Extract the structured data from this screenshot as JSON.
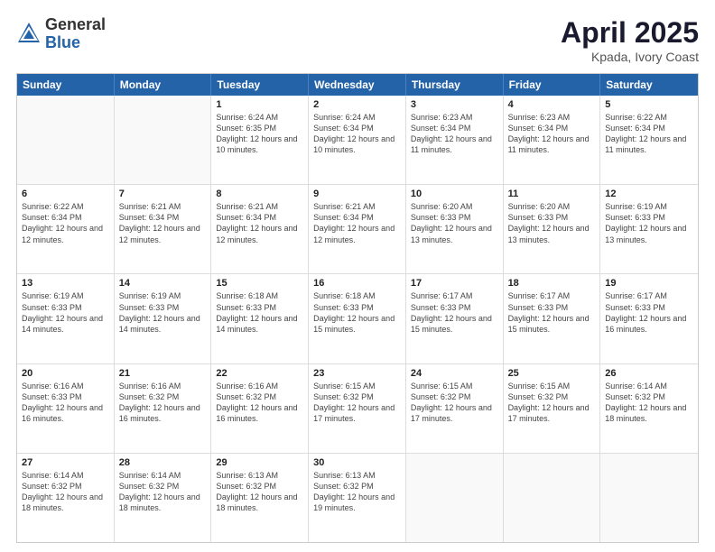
{
  "logo": {
    "general": "General",
    "blue": "Blue"
  },
  "title": "April 2025",
  "location": "Kpada, Ivory Coast",
  "header_days": [
    "Sunday",
    "Monday",
    "Tuesday",
    "Wednesday",
    "Thursday",
    "Friday",
    "Saturday"
  ],
  "rows": [
    [
      {
        "day": "",
        "info": ""
      },
      {
        "day": "",
        "info": ""
      },
      {
        "day": "1",
        "info": "Sunrise: 6:24 AM\nSunset: 6:35 PM\nDaylight: 12 hours and 10 minutes."
      },
      {
        "day": "2",
        "info": "Sunrise: 6:24 AM\nSunset: 6:34 PM\nDaylight: 12 hours and 10 minutes."
      },
      {
        "day": "3",
        "info": "Sunrise: 6:23 AM\nSunset: 6:34 PM\nDaylight: 12 hours and 11 minutes."
      },
      {
        "day": "4",
        "info": "Sunrise: 6:23 AM\nSunset: 6:34 PM\nDaylight: 12 hours and 11 minutes."
      },
      {
        "day": "5",
        "info": "Sunrise: 6:22 AM\nSunset: 6:34 PM\nDaylight: 12 hours and 11 minutes."
      }
    ],
    [
      {
        "day": "6",
        "info": "Sunrise: 6:22 AM\nSunset: 6:34 PM\nDaylight: 12 hours and 12 minutes."
      },
      {
        "day": "7",
        "info": "Sunrise: 6:21 AM\nSunset: 6:34 PM\nDaylight: 12 hours and 12 minutes."
      },
      {
        "day": "8",
        "info": "Sunrise: 6:21 AM\nSunset: 6:34 PM\nDaylight: 12 hours and 12 minutes."
      },
      {
        "day": "9",
        "info": "Sunrise: 6:21 AM\nSunset: 6:34 PM\nDaylight: 12 hours and 12 minutes."
      },
      {
        "day": "10",
        "info": "Sunrise: 6:20 AM\nSunset: 6:33 PM\nDaylight: 12 hours and 13 minutes."
      },
      {
        "day": "11",
        "info": "Sunrise: 6:20 AM\nSunset: 6:33 PM\nDaylight: 12 hours and 13 minutes."
      },
      {
        "day": "12",
        "info": "Sunrise: 6:19 AM\nSunset: 6:33 PM\nDaylight: 12 hours and 13 minutes."
      }
    ],
    [
      {
        "day": "13",
        "info": "Sunrise: 6:19 AM\nSunset: 6:33 PM\nDaylight: 12 hours and 14 minutes."
      },
      {
        "day": "14",
        "info": "Sunrise: 6:19 AM\nSunset: 6:33 PM\nDaylight: 12 hours and 14 minutes."
      },
      {
        "day": "15",
        "info": "Sunrise: 6:18 AM\nSunset: 6:33 PM\nDaylight: 12 hours and 14 minutes."
      },
      {
        "day": "16",
        "info": "Sunrise: 6:18 AM\nSunset: 6:33 PM\nDaylight: 12 hours and 15 minutes."
      },
      {
        "day": "17",
        "info": "Sunrise: 6:17 AM\nSunset: 6:33 PM\nDaylight: 12 hours and 15 minutes."
      },
      {
        "day": "18",
        "info": "Sunrise: 6:17 AM\nSunset: 6:33 PM\nDaylight: 12 hours and 15 minutes."
      },
      {
        "day": "19",
        "info": "Sunrise: 6:17 AM\nSunset: 6:33 PM\nDaylight: 12 hours and 16 minutes."
      }
    ],
    [
      {
        "day": "20",
        "info": "Sunrise: 6:16 AM\nSunset: 6:33 PM\nDaylight: 12 hours and 16 minutes."
      },
      {
        "day": "21",
        "info": "Sunrise: 6:16 AM\nSunset: 6:32 PM\nDaylight: 12 hours and 16 minutes."
      },
      {
        "day": "22",
        "info": "Sunrise: 6:16 AM\nSunset: 6:32 PM\nDaylight: 12 hours and 16 minutes."
      },
      {
        "day": "23",
        "info": "Sunrise: 6:15 AM\nSunset: 6:32 PM\nDaylight: 12 hours and 17 minutes."
      },
      {
        "day": "24",
        "info": "Sunrise: 6:15 AM\nSunset: 6:32 PM\nDaylight: 12 hours and 17 minutes."
      },
      {
        "day": "25",
        "info": "Sunrise: 6:15 AM\nSunset: 6:32 PM\nDaylight: 12 hours and 17 minutes."
      },
      {
        "day": "26",
        "info": "Sunrise: 6:14 AM\nSunset: 6:32 PM\nDaylight: 12 hours and 18 minutes."
      }
    ],
    [
      {
        "day": "27",
        "info": "Sunrise: 6:14 AM\nSunset: 6:32 PM\nDaylight: 12 hours and 18 minutes."
      },
      {
        "day": "28",
        "info": "Sunrise: 6:14 AM\nSunset: 6:32 PM\nDaylight: 12 hours and 18 minutes."
      },
      {
        "day": "29",
        "info": "Sunrise: 6:13 AM\nSunset: 6:32 PM\nDaylight: 12 hours and 18 minutes."
      },
      {
        "day": "30",
        "info": "Sunrise: 6:13 AM\nSunset: 6:32 PM\nDaylight: 12 hours and 19 minutes."
      },
      {
        "day": "",
        "info": ""
      },
      {
        "day": "",
        "info": ""
      },
      {
        "day": "",
        "info": ""
      }
    ]
  ]
}
